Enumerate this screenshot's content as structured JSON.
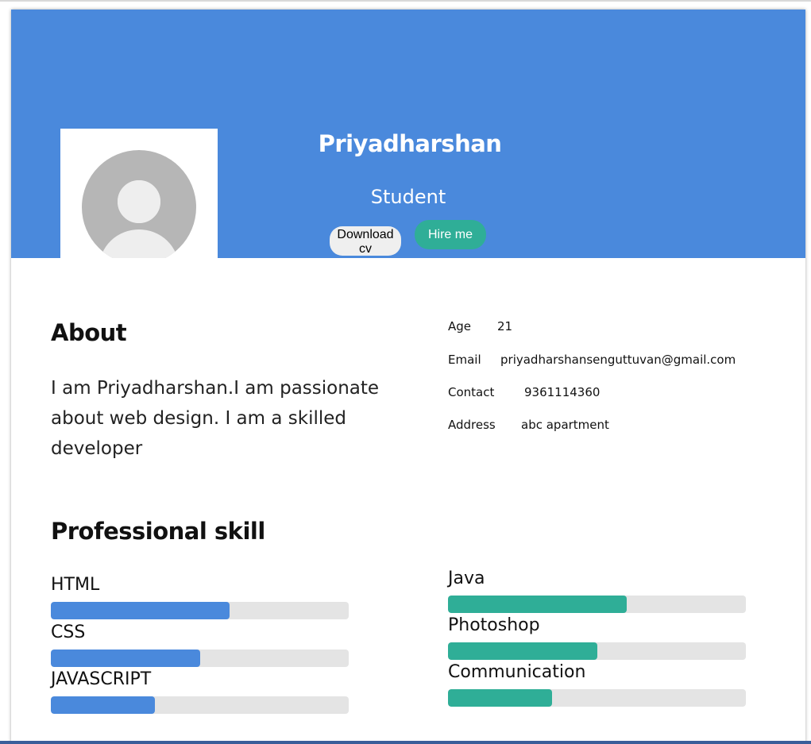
{
  "profile": {
    "name": "Priyadharshan",
    "role": "Student",
    "download_label": "Download cv",
    "hire_label": "Hire me"
  },
  "about": {
    "heading": "About",
    "text": "I am Priyadharshan.I am passionate about web design. I am a skilled developer"
  },
  "info": [
    {
      "label": "Age",
      "value": "21"
    },
    {
      "label": "Email",
      "value": "priyadharshansenguttuvan@gmail.com"
    },
    {
      "label": "Contact",
      "value": "9361114360"
    },
    {
      "label": "Address",
      "value": "abc apartment"
    }
  ],
  "skills": {
    "heading": "Professional skill",
    "left": [
      {
        "name": "HTML",
        "percent": 60
      },
      {
        "name": "CSS",
        "percent": 50
      },
      {
        "name": "JAVASCRIPT",
        "percent": 35
      }
    ],
    "right": [
      {
        "name": "Java",
        "percent": 60
      },
      {
        "name": "Photoshop",
        "percent": 50
      },
      {
        "name": "Communication",
        "percent": 35
      }
    ]
  },
  "colors": {
    "header": "#4a89dc",
    "accent_green": "#2fae97",
    "bar_track": "#e4e4e4"
  },
  "icons": {
    "avatar": "user-avatar-placeholder-icon"
  }
}
